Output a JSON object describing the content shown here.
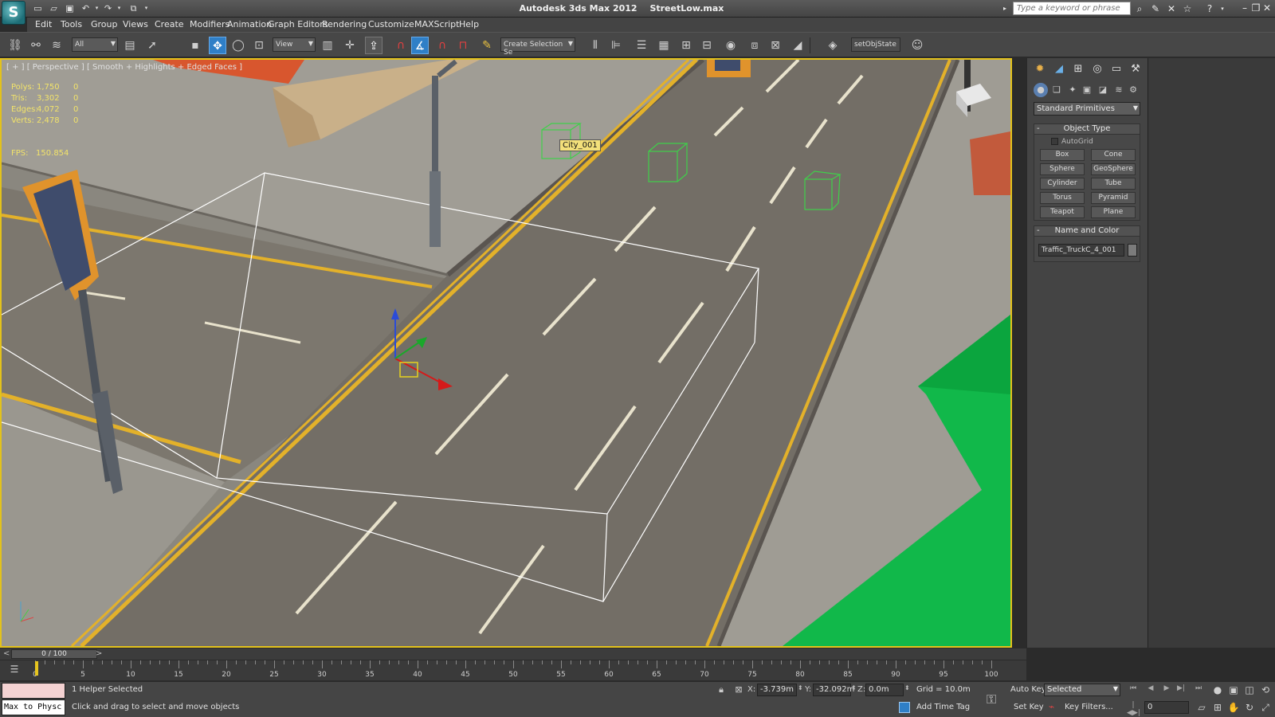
{
  "window": {
    "app_name": "Autodesk 3ds Max  2012",
    "file_name": "StreetLow.max",
    "search_placeholder": "Type a keyword or phrase"
  },
  "menu": [
    "Edit",
    "Tools",
    "Group",
    "Views",
    "Create",
    "Modifiers",
    "Animation",
    "Graph Editors",
    "Rendering",
    "Customize",
    "MAXScript",
    "Help"
  ],
  "toolbar": {
    "selection_filter": "All",
    "reference_coord": "View",
    "named_selection": "Create Selection Se",
    "script_label": "setObjState"
  },
  "viewport": {
    "label": "[ + ] [ Perspective ] [ Smooth + Highlights + Edged Faces ]",
    "stats": [
      {
        "key": "Polys:",
        "total": "1,750",
        "selected": "0"
      },
      {
        "key": "Tris:",
        "total": "3,302",
        "selected": "0"
      },
      {
        "key": "Edges:",
        "total": "4,072",
        "selected": "0"
      },
      {
        "key": "Verts:",
        "total": "2,478",
        "selected": "0"
      }
    ],
    "fps_label": "FPS:",
    "fps_value": "150.854",
    "object_tag": "City_001"
  },
  "command_panel": {
    "category": "Standard Primitives",
    "object_type_title": "Object Type",
    "autogrid_label": "AutoGrid",
    "primitives": [
      "Box",
      "Cone",
      "Sphere",
      "GeoSphere",
      "Cylinder",
      "Tube",
      "Torus",
      "Pyramid",
      "Teapot",
      "Plane"
    ],
    "name_color_title": "Name and Color",
    "object_name": "Traffic_TruckC_4_001"
  },
  "timeline": {
    "frame_readout": "0 / 100",
    "ticks": [
      "0",
      "5",
      "10",
      "15",
      "20",
      "25",
      "30",
      "35",
      "40",
      "45",
      "50",
      "55",
      "60",
      "65",
      "70",
      "75",
      "80",
      "85",
      "90",
      "95",
      "100"
    ]
  },
  "status": {
    "maxscript_text": "Max to Physc",
    "selection_info": "1 Helper Selected",
    "prompt": "Click and drag to select and move objects",
    "x_label": "X:",
    "x_value": "-3.739m",
    "y_label": "Y:",
    "y_value": "-32.092m",
    "z_label": "Z:",
    "z_value": "0.0m",
    "grid": "Grid = 10.0m",
    "add_time_tag": "Add Time Tag",
    "auto_key": "Auto Key",
    "set_key": "Set Key",
    "key_mode": "Selected",
    "key_filters": "Key Filters...",
    "current_frame": "0"
  }
}
